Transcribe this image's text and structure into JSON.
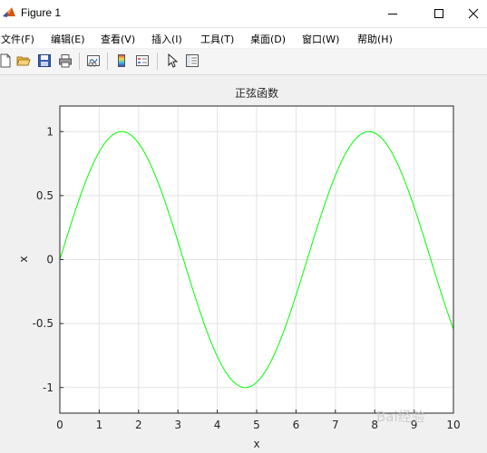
{
  "window": {
    "title": "Figure 1",
    "icon": "matlab-icon"
  },
  "menu": [
    {
      "label": "文件(F)"
    },
    {
      "label": "编辑(E)"
    },
    {
      "label": "查看(V)"
    },
    {
      "label": "插入(I)"
    },
    {
      "label": "工具(T)"
    },
    {
      "label": "桌面(D)"
    },
    {
      "label": "窗口(W)"
    },
    {
      "label": "帮助(H)"
    }
  ],
  "toolbar": {
    "buttons": [
      "new-figure-icon",
      "open-file-icon",
      "save-icon",
      "print-icon",
      "link-plot-icon",
      "colorbar-icon",
      "legend-icon",
      "pointer-icon",
      "property-inspector-icon"
    ]
  },
  "watermark": "Bai经验",
  "chart_data": {
    "type": "line",
    "title": "正弦函数",
    "xlabel": "x",
    "ylabel": "x",
    "xlim": [
      0,
      10
    ],
    "ylim": [
      -1.2,
      1.2
    ],
    "xticks": [
      "0",
      "1",
      "2",
      "3",
      "4",
      "5",
      "6",
      "7",
      "8",
      "9",
      "10"
    ],
    "yticks": [
      "-1",
      "-0.5",
      "0",
      "0.5",
      "1"
    ],
    "grid": true,
    "series": [
      {
        "function": "sin(x)",
        "color": "#00ff00",
        "x": [
          0,
          0.5,
          1,
          1.5,
          1.5708,
          2,
          2.5,
          3,
          3.5,
          4,
          4.5,
          4.7124,
          5,
          5.5,
          6,
          6.5,
          7,
          7.5,
          7.854,
          8,
          8.5,
          9,
          9.5,
          10
        ],
        "y": [
          0,
          0.479,
          0.841,
          0.997,
          1,
          0.909,
          0.598,
          0.141,
          -0.351,
          -0.757,
          -0.978,
          -1,
          -0.959,
          -0.706,
          -0.279,
          0.215,
          0.657,
          0.938,
          1,
          0.989,
          0.798,
          0.412,
          -0.075,
          -0.544
        ]
      }
    ]
  }
}
